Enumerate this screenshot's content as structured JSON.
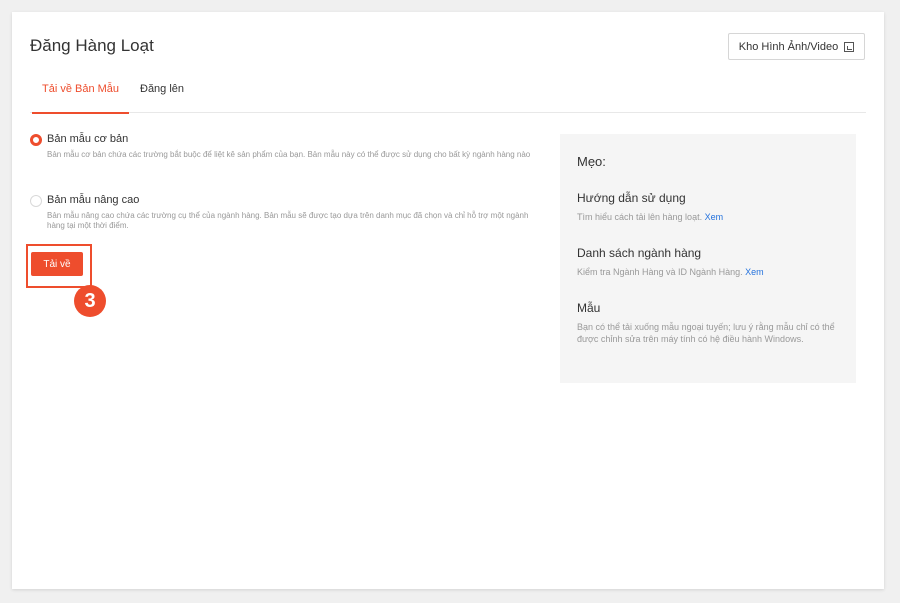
{
  "page": {
    "title": "Đăng Hàng Loạt",
    "media_button_label": "Kho Hình Ảnh/Video"
  },
  "tabs": [
    {
      "label": "Tải về Bản Mẫu",
      "active": true
    },
    {
      "label": "Đăng lên",
      "active": false
    }
  ],
  "options": [
    {
      "title": "Bản mẫu cơ bản",
      "desc": "Bản mẫu cơ bản chứa các trường bắt buộc để liệt kê sản phẩm của bạn. Bản mẫu này có thể được sử dụng cho bất kỳ ngành hàng nào",
      "selected": true
    },
    {
      "title": "Bản mẫu nâng cao",
      "desc": "Bản mẫu nâng cao chứa các trường cụ thể của ngành hàng. Bản mẫu sẽ được tạo dựa trên danh mục đã chọn và chỉ hỗ trợ một ngành hàng tại một thời điểm.",
      "selected": false
    }
  ],
  "download_button_label": "Tải về",
  "step_badge": "3",
  "tips": {
    "title": "Mẹo:",
    "items": [
      {
        "title": "Hướng dẫn sử dụng",
        "desc": "Tìm hiểu cách tải lên hàng loạt.",
        "link": "Xem"
      },
      {
        "title": "Danh sách ngành hàng",
        "desc": "Kiểm tra Ngành Hàng và ID Ngành Hàng.",
        "link": "Xem"
      },
      {
        "title": "Mẫu",
        "desc": "Bạn có thể tải xuống mẫu ngoại tuyến; lưu ý rằng mẫu chỉ có thể được chỉnh sửa trên máy tính có hệ điều hành Windows.",
        "link": ""
      }
    ]
  },
  "colors": {
    "accent": "#ee4d2d",
    "link": "#2673dd",
    "tips_bg": "#f5f5f5",
    "page_bg": "#f0f0f0"
  },
  "icons": {
    "media_button_icon": "image-gallery-icon"
  }
}
